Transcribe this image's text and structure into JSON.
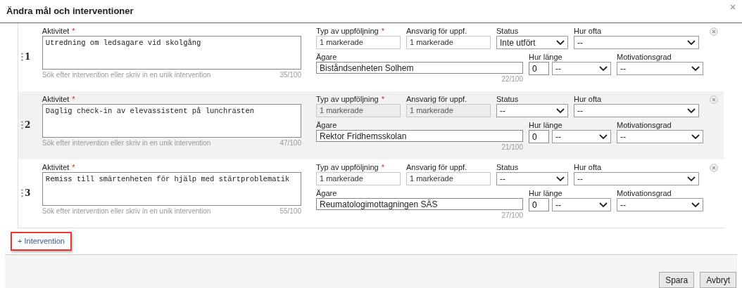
{
  "dialog": {
    "title": "Ändra mål och interventioner"
  },
  "interventions": [
    {
      "number": "1",
      "labels": {
        "activity": "Aktivitet",
        "followup_type": "Typ av uppföljning",
        "responsible": "Ansvarig för uppf.",
        "status": "Status",
        "frequency": "Hur ofta",
        "owner": "Ägare",
        "duration": "Hur länge",
        "motivation": "Motivationsgrad",
        "required_activity": "*",
        "required_followup": "*"
      },
      "activity": "Utredning om ledsagare vid skolgång",
      "hint": "Sök efter intervention eller skriv in en unik intervention",
      "activity_count": "35/100",
      "followup_type": "1 markerade",
      "responsible": "1 markerade",
      "fields_disabled": false,
      "status": "Inte utfört",
      "frequency": "--",
      "owner": "Biståndsenheten Solhem",
      "owner_count": "22/100",
      "duration_value": "0",
      "duration_unit": "--",
      "motivation": "--"
    },
    {
      "number": "2",
      "labels": {
        "activity": "Aktivitet",
        "followup_type": "Typ av uppföljning",
        "responsible": "Ansvarig för uppf.",
        "status": "Status",
        "frequency": "Hur ofta",
        "owner": "Ägare",
        "duration": "Hur länge",
        "motivation": "Motivationsgrad",
        "required_activity": "*",
        "required_followup": "*"
      },
      "activity": "Daglig check-in av elevassistent på lunchrasten",
      "hint": "Sök efter intervention eller skriv in en unik intervention",
      "activity_count": "47/100",
      "followup_type": "1 markerade",
      "responsible": "1 markerade",
      "fields_disabled": true,
      "status": "--",
      "frequency": "--",
      "owner": "Rektor Fridhemsskolan",
      "owner_count": "21/100",
      "duration_value": "0",
      "duration_unit": "--",
      "motivation": "--"
    },
    {
      "number": "3",
      "labels": {
        "activity": "Aktivitet",
        "followup_type": "Typ av uppföljning",
        "responsible": "Ansvarig för uppf.",
        "status": "Status",
        "frequency": "Hur ofta",
        "owner": "Ägare",
        "duration": "Hur länge",
        "motivation": "Motivationsgrad",
        "required_activity": "*",
        "required_followup": "*"
      },
      "activity": "Remiss till smärtenheten för hjälp med stärtproblematik",
      "hint": "Sök efter intervention eller skriv in en unik intervention",
      "activity_count": "55/100",
      "followup_type": "1 markerade",
      "responsible": "1 markerade",
      "fields_disabled": false,
      "status": "--",
      "frequency": "--",
      "owner": "Reumatologimottagningen SÄS",
      "owner_count": "27/100",
      "duration_value": "0",
      "duration_unit": "--",
      "motivation": "--"
    }
  ],
  "add_button": {
    "label": "+ Intervention"
  },
  "footer": {
    "buttons": [
      "Spara",
      "Avbryt"
    ]
  }
}
